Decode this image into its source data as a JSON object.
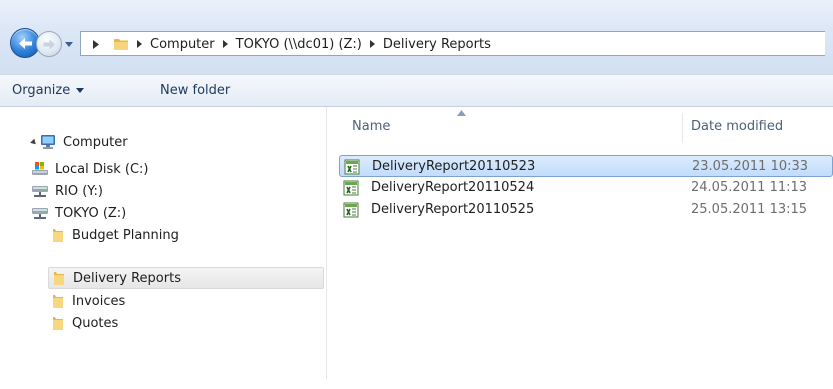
{
  "address_bar": {
    "breadcrumbs": [
      "Computer",
      "TOKYO (\\\\dc01) (Z:)",
      "Delivery Reports"
    ]
  },
  "toolbar": {
    "organize_label": "Organize",
    "new_folder_label": "New folder"
  },
  "navigation": {
    "computer_label": "Computer",
    "items": [
      {
        "label": "Local Disk (C:)",
        "icon": "local-disk-icon"
      },
      {
        "label": "RIO  (Y:)",
        "icon": "network-drive-icon"
      },
      {
        "label": "TOKYO  (Z:)",
        "icon": "network-drive-icon"
      },
      {
        "label": "Budget Planning",
        "icon": "folder-icon"
      },
      {
        "label": "Delivery Reports",
        "icon": "folder-icon",
        "selected": true
      },
      {
        "label": "Invoices",
        "icon": "folder-icon"
      },
      {
        "label": "Quotes",
        "icon": "folder-icon"
      }
    ]
  },
  "file_list": {
    "columns": {
      "name": "Name",
      "date_modified": "Date modified"
    },
    "files": [
      {
        "name": "DeliveryReport20110523",
        "date": "23.05.2011 10:33",
        "icon": "excel-file-icon",
        "selected": true
      },
      {
        "name": "DeliveryReport20110524",
        "date": "24.05.2011 11:13",
        "icon": "excel-file-icon"
      },
      {
        "name": "DeliveryReport20110525",
        "date": "25.05.2011 13:15",
        "icon": "excel-file-icon"
      }
    ]
  },
  "colors": {
    "selection_blue": "#c1dcfc",
    "selection_border": "#7da2ce",
    "toolbar_text": "#1e395b",
    "header_text": "#4c607a"
  }
}
